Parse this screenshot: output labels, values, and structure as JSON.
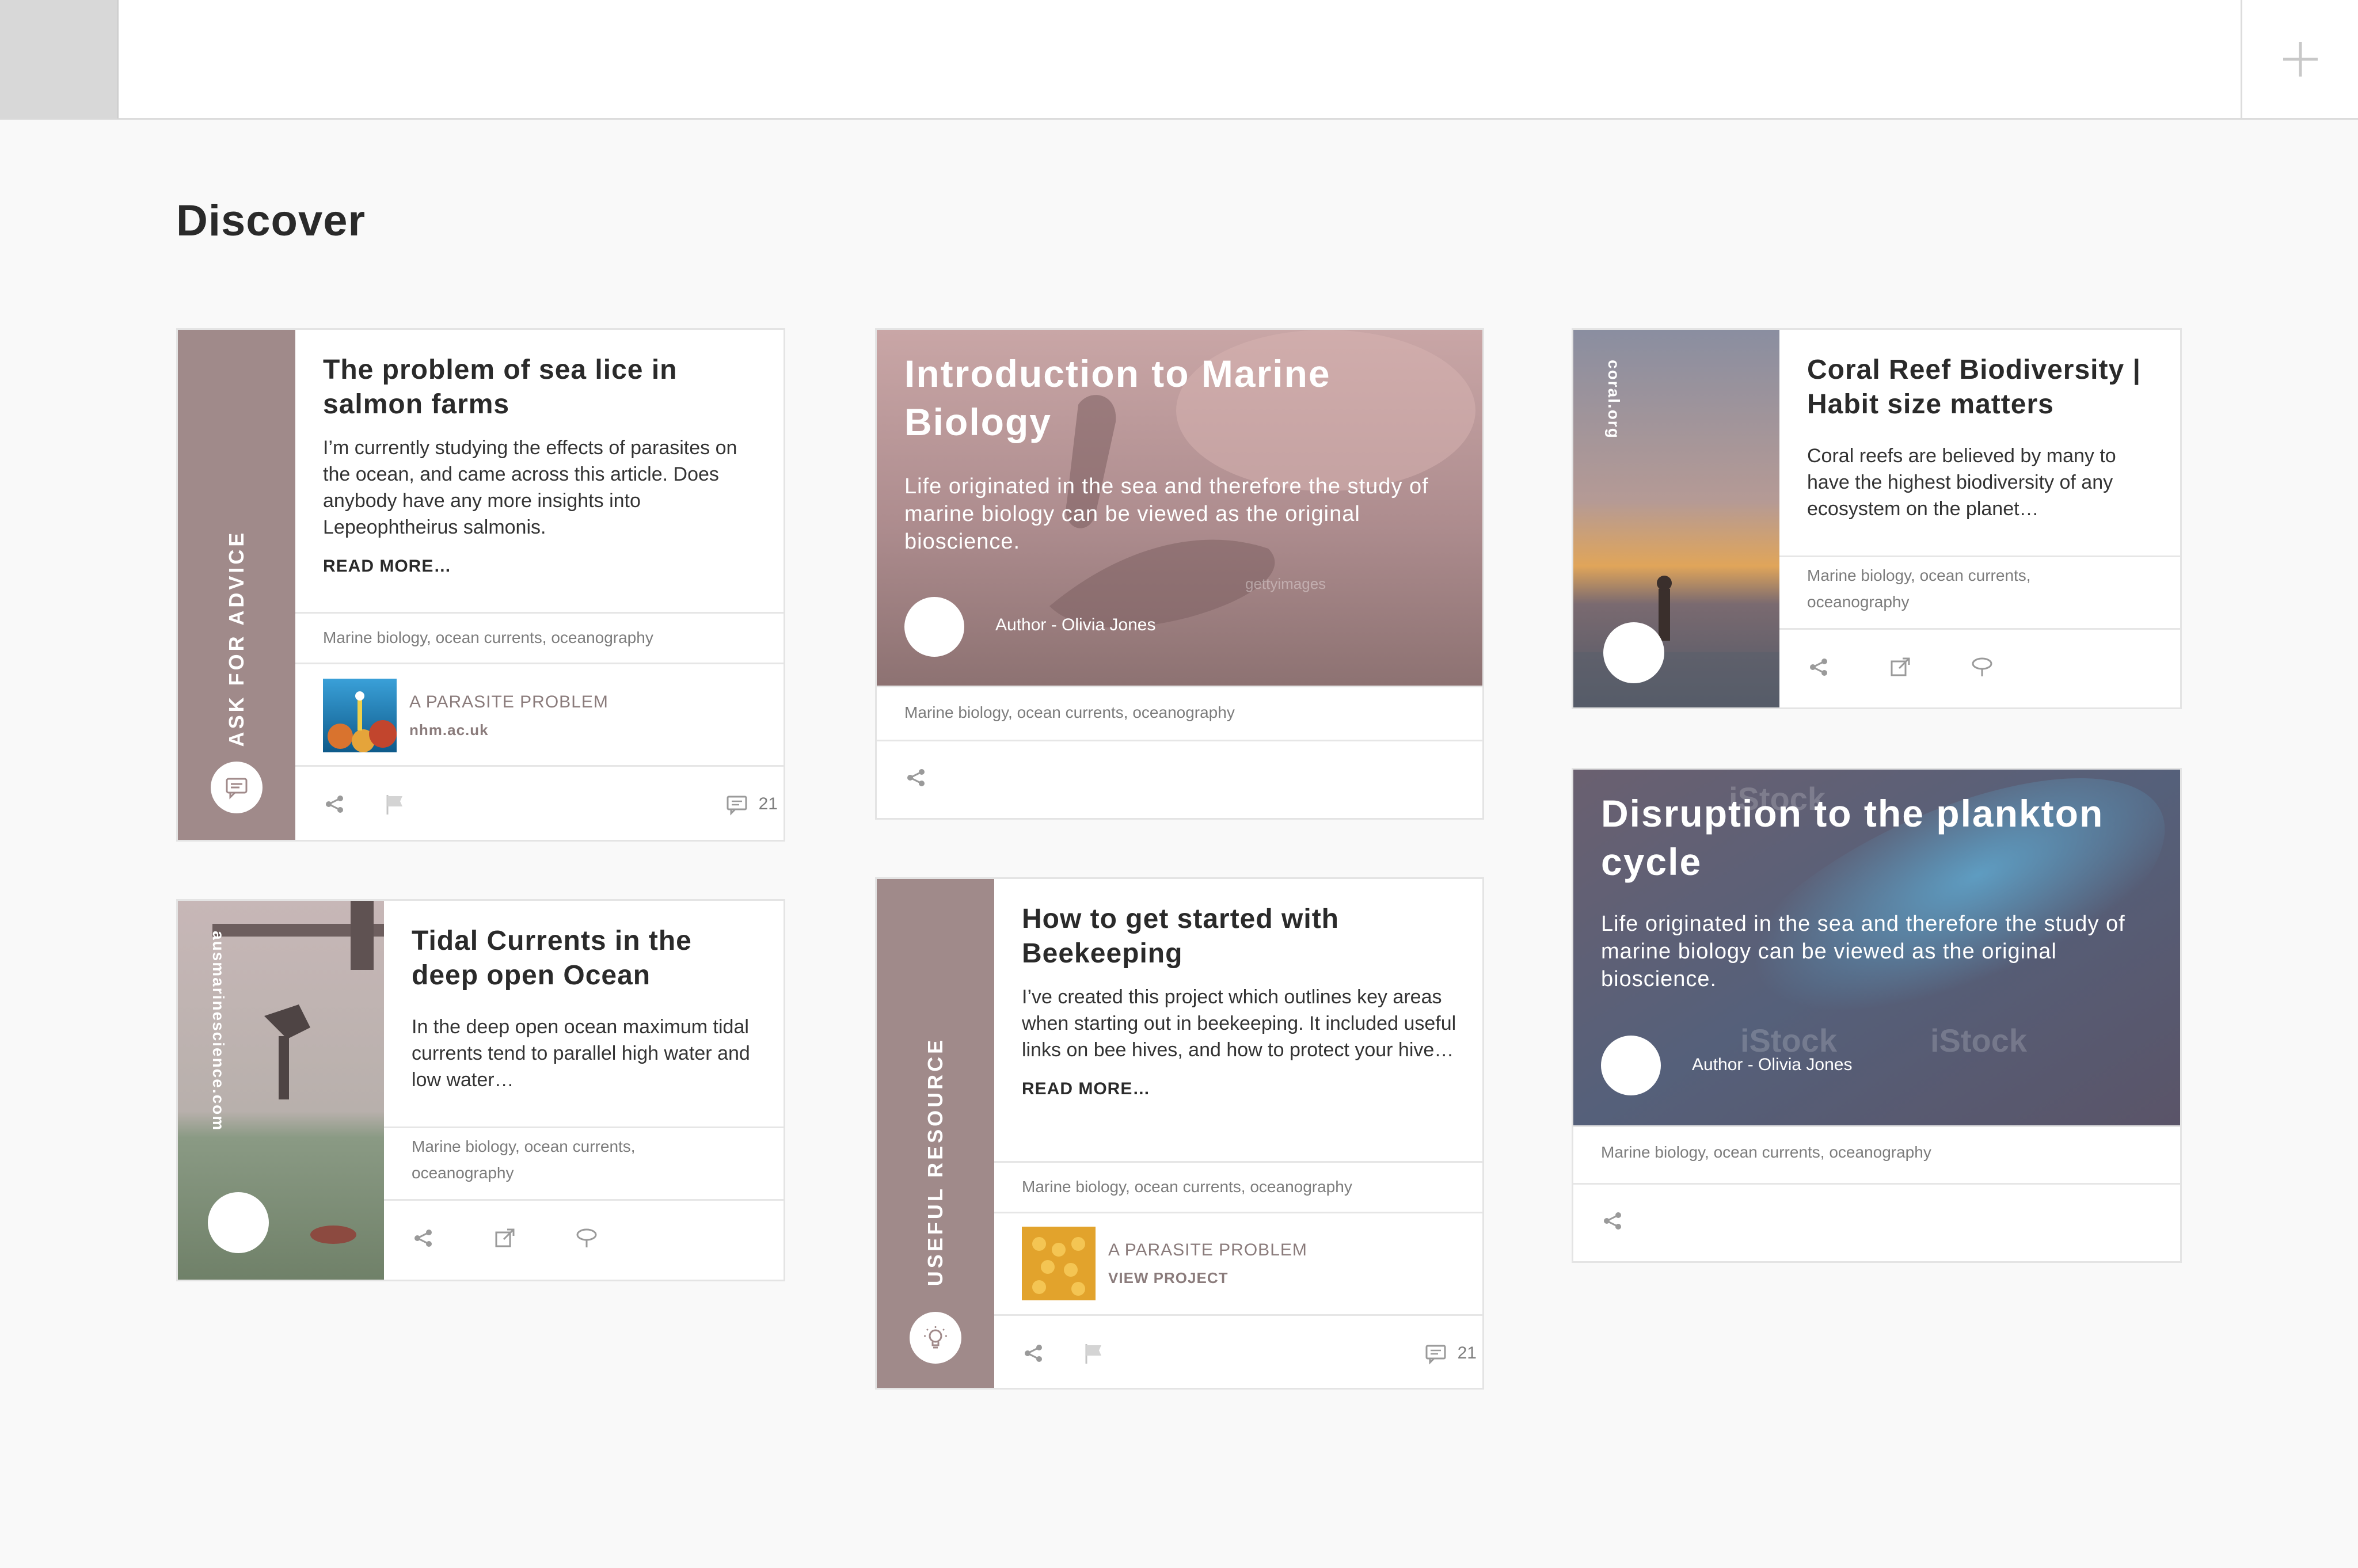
{
  "page": {
    "title": "Discover"
  },
  "colors": {
    "accent": "#a08a8a",
    "background": "#f9f9f9",
    "card": "#ffffff",
    "icon": "#9a9a9a"
  },
  "cards": {
    "sea_lice": {
      "category": "ASK FOR ADVICE",
      "category_icon": "speech-bubble-icon",
      "title": "The problem of sea lice in salmon farms",
      "body": "I’m currently studying the effects of parasites on the ocean, and came across this article. Does anybody have any more insights into Lepeophtheirus salmonis.",
      "read_more": "READ MORE…",
      "tags": "Marine biology, ocean currents,  oceanography",
      "ref_title": "A PARASITE PROBLEM",
      "ref_sub": "nhm.ac.uk",
      "comment_count": "21"
    },
    "marine_intro": {
      "title": "Introduction to Marine Biology",
      "body": "Life originated in the sea and therefore the study of marine biology can be viewed as the original bioscience.",
      "author": "Author - Olivia Jones",
      "watermark": "gettyimages",
      "tags": "Marine biology, ocean currents,  oceanography"
    },
    "coral": {
      "source": "coral.org",
      "title": "Coral Reef Biodiversity | Habit size matters",
      "body": "Coral reefs are believed by many to have the highest biodiversity of any ecosystem on the planet…",
      "tags": "Marine biology, ocean currents, oceanography"
    },
    "tidal": {
      "source": "ausmarinescience.com",
      "title": "Tidal Currents in the deep open Ocean",
      "body": "In the deep open ocean maximum tidal currents tend to parallel high water and low water…",
      "tags": "Marine biology, ocean currents, oceanography"
    },
    "bees": {
      "category": "USEFUL RESOURCE",
      "category_icon": "lightbulb-icon",
      "title": "How to get started with Beekeeping",
      "body": "I’ve created this project which outlines key areas when starting out in beekeeping. It included useful links on bee hives, and how to protect your hive…",
      "read_more": "READ MORE…",
      "tags": "Marine biology, ocean currents,  oceanography",
      "ref_title": "A PARASITE PROBLEM",
      "ref_sub": "VIEW PROJECT",
      "comment_count": "21"
    },
    "plankton": {
      "title": "Disruption to the plankton cycle",
      "body": "Life originated in the sea and therefore the study of marine biology can be viewed as the original bioscience.",
      "author": "Author - Olivia Jones",
      "watermark": "iStock",
      "tags": "Marine biology, ocean currents,  oceanography"
    }
  }
}
